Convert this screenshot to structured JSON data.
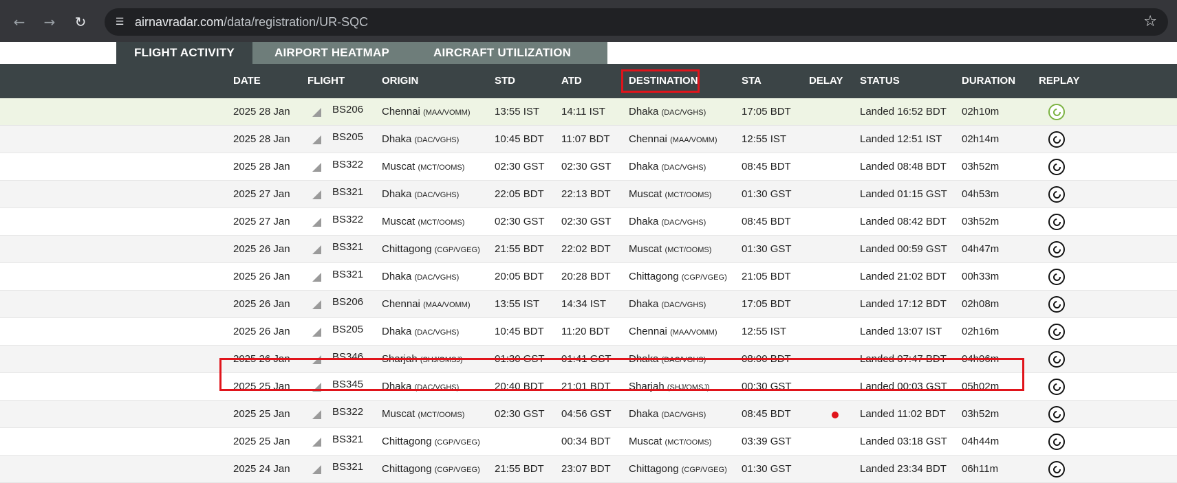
{
  "browser": {
    "url_host": "airnavradar.com",
    "url_path": "/data/registration/UR-SQC"
  },
  "tabs": [
    {
      "label": "FLIGHT ACTIVITY",
      "active": true
    },
    {
      "label": "AIRPORT HEATMAP",
      "active": false
    },
    {
      "label": "AIRCRAFT UTILIZATION",
      "active": false
    }
  ],
  "columns": {
    "date": "DATE",
    "flight": "FLIGHT",
    "origin": "ORIGIN",
    "std": "STD",
    "atd": "ATD",
    "destination": "DESTINATION",
    "sta": "STA",
    "delay": "DELAY",
    "status": "STATUS",
    "duration": "DURATION",
    "replay": "REPLAY"
  },
  "rows": [
    {
      "date": "2025 28 Jan",
      "flight": "BS206",
      "origin": "Chennai",
      "origin_code": "(MAA/VOMM)",
      "std": "13:55 IST",
      "atd": "14:11 IST",
      "dest": "Dhaka",
      "dest_code": "(DAC/VGHS)",
      "sta": "17:05 BDT",
      "status": "Landed 16:52 BDT",
      "duration": "02h10m"
    },
    {
      "date": "2025 28 Jan",
      "flight": "BS205",
      "origin": "Dhaka",
      "origin_code": "(DAC/VGHS)",
      "std": "10:45 BDT",
      "atd": "11:07 BDT",
      "dest": "Chennai",
      "dest_code": "(MAA/VOMM)",
      "sta": "12:55 IST",
      "status": "Landed 12:51 IST",
      "duration": "02h14m"
    },
    {
      "date": "2025 28 Jan",
      "flight": "BS322",
      "origin": "Muscat",
      "origin_code": "(MCT/OOMS)",
      "std": "02:30 GST",
      "atd": "02:30 GST",
      "dest": "Dhaka",
      "dest_code": "(DAC/VGHS)",
      "sta": "08:45 BDT",
      "status": "Landed 08:48 BDT",
      "duration": "03h52m"
    },
    {
      "date": "2025 27 Jan",
      "flight": "BS321",
      "origin": "Dhaka",
      "origin_code": "(DAC/VGHS)",
      "std": "22:05 BDT",
      "atd": "22:13 BDT",
      "dest": "Muscat",
      "dest_code": "(MCT/OOMS)",
      "sta": "01:30 GST",
      "status": "Landed 01:15 GST",
      "duration": "04h53m"
    },
    {
      "date": "2025 27 Jan",
      "flight": "BS322",
      "origin": "Muscat",
      "origin_code": "(MCT/OOMS)",
      "std": "02:30 GST",
      "atd": "02:30 GST",
      "dest": "Dhaka",
      "dest_code": "(DAC/VGHS)",
      "sta": "08:45 BDT",
      "status": "Landed 08:42 BDT",
      "duration": "03h52m"
    },
    {
      "date": "2025 26 Jan",
      "flight": "BS321",
      "origin": "Chittagong",
      "origin_code": "(CGP/VGEG)",
      "std": "21:55 BDT",
      "atd": "22:02 BDT",
      "dest": "Muscat",
      "dest_code": "(MCT/OOMS)",
      "sta": "01:30 GST",
      "status": "Landed 00:59 GST",
      "duration": "04h47m"
    },
    {
      "date": "2025 26 Jan",
      "flight": "BS321",
      "origin": "Dhaka",
      "origin_code": "(DAC/VGHS)",
      "std": "20:05 BDT",
      "atd": "20:28 BDT",
      "dest": "Chittagong",
      "dest_code": "(CGP/VGEG)",
      "sta": "21:05 BDT",
      "status": "Landed 21:02 BDT",
      "duration": "00h33m"
    },
    {
      "date": "2025 26 Jan",
      "flight": "BS206",
      "origin": "Chennai",
      "origin_code": "(MAA/VOMM)",
      "std": "13:55 IST",
      "atd": "14:34 IST",
      "dest": "Dhaka",
      "dest_code": "(DAC/VGHS)",
      "sta": "17:05 BDT",
      "status": "Landed 17:12 BDT",
      "duration": "02h08m"
    },
    {
      "date": "2025 26 Jan",
      "flight": "BS205",
      "origin": "Dhaka",
      "origin_code": "(DAC/VGHS)",
      "std": "10:45 BDT",
      "atd": "11:20 BDT",
      "dest": "Chennai",
      "dest_code": "(MAA/VOMM)",
      "sta": "12:55 IST",
      "status": "Landed 13:07 IST",
      "duration": "02h16m"
    },
    {
      "date": "2025 26 Jan",
      "flight": "BS346",
      "origin": "Sharjah",
      "origin_code": "(SHJ/OMSJ)",
      "std": "01:30 GST",
      "atd": "01:41 GST",
      "dest": "Dhaka",
      "dest_code": "(DAC/VGHS)",
      "sta": "08:00 BDT",
      "status": "Landed 07:47 BDT",
      "duration": "04h06m"
    },
    {
      "date": "2025 25 Jan",
      "flight": "BS345",
      "origin": "Dhaka",
      "origin_code": "(DAC/VGHS)",
      "std": "20:40 BDT",
      "atd": "21:01 BDT",
      "dest": "Sharjah",
      "dest_code": "(SHJ/OMSJ)",
      "sta": "00:30 GST",
      "status": "Landed 00:03 GST",
      "duration": "05h02m"
    },
    {
      "date": "2025 25 Jan",
      "flight": "BS322",
      "origin": "Muscat",
      "origin_code": "(MCT/OOMS)",
      "std": "02:30 GST",
      "atd": "04:56 GST",
      "dest": "Dhaka",
      "dest_code": "(DAC/VGHS)",
      "sta": "08:45 BDT",
      "status": "Landed 11:02 BDT",
      "duration": "03h52m"
    },
    {
      "date": "2025 25 Jan",
      "flight": "BS321",
      "origin": "Chittagong",
      "origin_code": "(CGP/VGEG)",
      "std": "",
      "atd": "00:34 BDT",
      "dest": "Muscat",
      "dest_code": "(MCT/OOMS)",
      "sta": "03:39 GST",
      "status": "Landed 03:18 GST",
      "duration": "04h44m"
    },
    {
      "date": "2025 24 Jan",
      "flight": "BS321",
      "origin": "Chittagong",
      "origin_code": "(CGP/VGEG)",
      "std": "21:55 BDT",
      "atd": "23:07 BDT",
      "dest": "Chittagong",
      "dest_code": "(CGP/VGEG)",
      "sta": "01:30 GST",
      "status": "Landed 23:34 BDT",
      "duration": "06h11m"
    }
  ],
  "colors": {
    "header_bg": "#3b4446",
    "tab_inactive": "#6e7d7a",
    "highlight": "#e0141b",
    "replay_active": "#7cb342",
    "first_row_bg": "#eef4e4"
  }
}
